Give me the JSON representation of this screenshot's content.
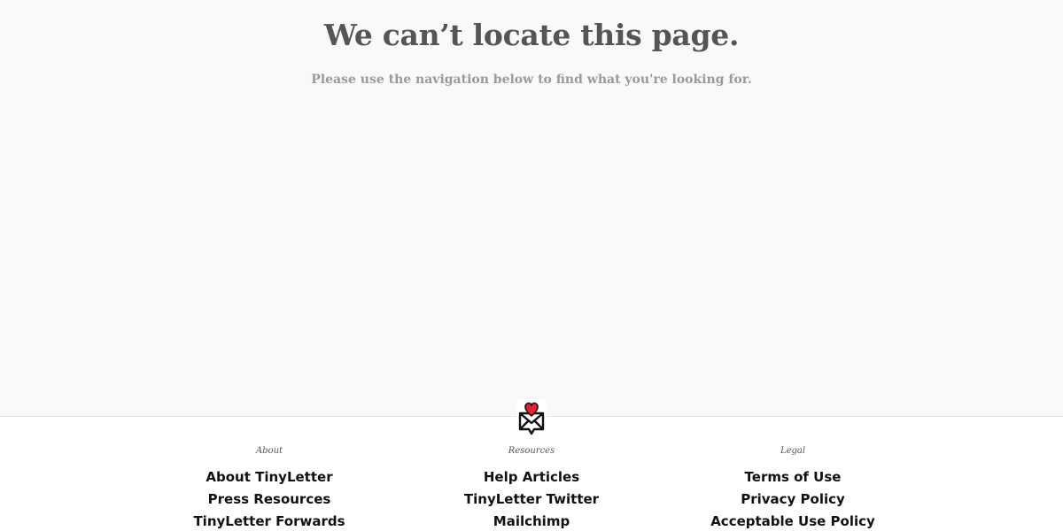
{
  "hero": {
    "title": "We can’t locate this page.",
    "subtitle": "Please use the navigation below to find what you're looking for."
  },
  "footer": {
    "logo_icon": "tinyletter-heart-envelope-icon",
    "columns": [
      {
        "heading": "About",
        "links": [
          "About TinyLetter",
          "Press Resources",
          "TinyLetter Forwards"
        ]
      },
      {
        "heading": "Resources",
        "links": [
          "Help Articles",
          "TinyLetter Twitter",
          "Mailchimp"
        ]
      },
      {
        "heading": "Legal",
        "links": [
          "Terms of Use",
          "Privacy Policy",
          "Acceptable Use Policy"
        ]
      }
    ]
  },
  "colors": {
    "heart": "#e8202a",
    "title": "#555555",
    "subtitle": "#9a9a9a"
  }
}
